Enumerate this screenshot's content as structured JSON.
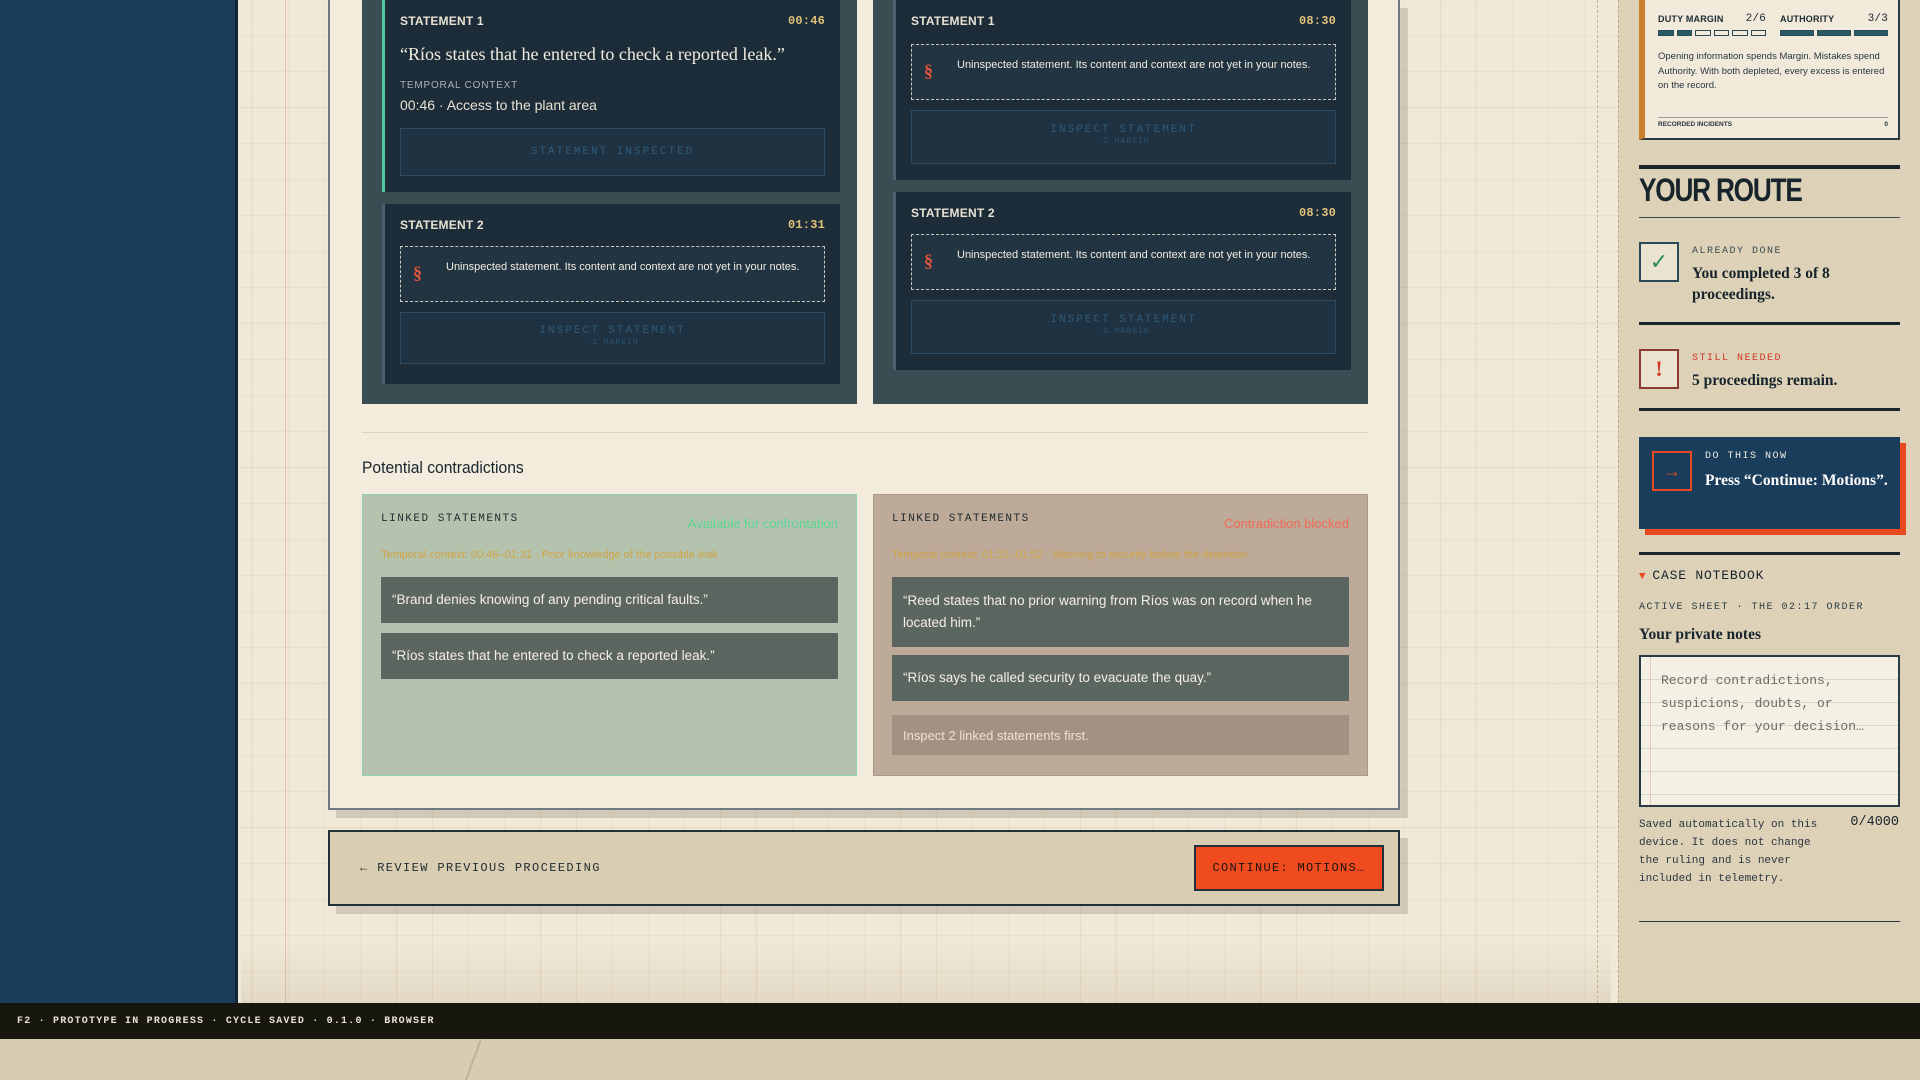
{
  "statements": {
    "left": [
      {
        "title": "STATEMENT 1",
        "time": "00:46",
        "quote": "“Ríos states that he entered to check a reported leak.”",
        "context_label": "TEMPORAL CONTEXT",
        "context_value": "00:46 · Access to the plant area",
        "button_label": "STATEMENT INSPECTED"
      },
      {
        "title": "STATEMENT 2",
        "time": "01:31",
        "locked_text": "Uninspected statement. Its content and context are not yet in your notes.",
        "button_label": "INSPECT STATEMENT",
        "button_sub": "-1 MARGIN"
      }
    ],
    "right": [
      {
        "title": "STATEMENT 1",
        "time": "08:30",
        "locked_text": "Uninspected statement. Its content and context are not yet in your notes.",
        "button_label": "INSPECT STATEMENT",
        "button_sub": "-1 MARGIN"
      },
      {
        "title": "STATEMENT 2",
        "time": "08:30",
        "locked_text": "Uninspected statement. Its content and context are not yet in your notes.",
        "button_label": "INSPECT STATEMENT",
        "button_sub": "-1 MARGIN"
      }
    ],
    "locked_symbol": "§"
  },
  "contradictions": {
    "title": "Potential contradictions",
    "cards": [
      {
        "label": "LINKED STATEMENTS",
        "status": "Available for confrontation",
        "temporal": "Temporal context: 00:46–01:31 · Prior knowledge of the possible leak",
        "statements": [
          "“Brand denies knowing of any pending critical faults.”",
          "“Ríos states that he entered to check a reported leak.”"
        ]
      },
      {
        "label": "LINKED STATEMENTS",
        "status": "Contradiction blocked",
        "temporal": "Temporal context: 01:31–01:52 · Warning to security before the detention",
        "statements": [
          "“Reed states that no prior warning from Ríos was on record when he located him.”",
          "“Ríos says he called security to evacuate the quay.”"
        ],
        "hint": "Inspect 2 linked statements first."
      }
    ]
  },
  "actions": {
    "previous": "← REVIEW PREVIOUS PROCEEDING",
    "continue": "CONTINUE: MOTIONS…"
  },
  "budget": {
    "duty_margin": {
      "label": "DUTY MARGIN",
      "value": "2/6",
      "filled": 2,
      "total": 6
    },
    "authority": {
      "label": "AUTHORITY",
      "value": "3/3",
      "filled": 3,
      "total": 3
    },
    "description": "Opening information spends Margin. Mistakes spend Authority. With both depleted, every excess is entered on the record.",
    "incidents_label": "RECORDED INCIDENTS",
    "incidents_value": "0"
  },
  "route": {
    "title": "YOUR ROUTE",
    "done": {
      "kicker": "ALREADY DONE",
      "text": "You completed 3 of 8 proceedings.",
      "icon": "✓"
    },
    "needed": {
      "kicker": "STILL NEEDED",
      "text": "5 proceedings remain.",
      "icon": "!"
    },
    "do_now": {
      "kicker": "DO THIS NOW",
      "text": "Press “Continue: Motions”.",
      "icon": "→"
    }
  },
  "notebook": {
    "header": "CASE NOTEBOOK",
    "sheet": "ACTIVE SHEET · THE 02:17 ORDER",
    "title": "Your private notes",
    "placeholder": "Record contradictions, suspicions, doubts, or reasons for your decision…",
    "note": "Saved automatically on this device. It does not change the ruling and is never included in telemetry.",
    "count": "0/4000"
  },
  "footer": {
    "status": "F2 · PROTOTYPE IN PROGRESS · CYCLE SAVED · 0.1.0 · BROWSER"
  },
  "colors": {
    "navy": "#1a3d5c",
    "accent_orange": "#f04b1e",
    "ok_green": "#5cd497",
    "blocked_red": "#f06a55",
    "paper": "#f1e9d7"
  }
}
